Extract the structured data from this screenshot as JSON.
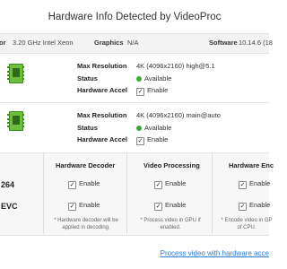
{
  "window": {
    "title": "Hardware Info Detected by VideoProc"
  },
  "infobar": {
    "cpu_label_fragment": "or",
    "cpu_value": "3.20 GHz Intel Xeon",
    "graphics_label": "Graphics",
    "graphics_value": "N/A",
    "software_label": "Software",
    "software_value": "10.14.6 (18"
  },
  "gpus": [
    {
      "max_resolution_label": "Max Resolution",
      "max_resolution_value": "4K (4096x2160) high@5.1",
      "status_label": "Status",
      "status_value": "Available",
      "hw_accel_label": "Hardware Accel",
      "hw_accel_value": "Enable"
    },
    {
      "max_resolution_label": "Max Resolution",
      "max_resolution_value": "4K (4096x2160) main@auto",
      "status_label": "Status",
      "status_value": "Available",
      "hw_accel_label": "Hardware Accel",
      "hw_accel_value": "Enable"
    }
  ],
  "table": {
    "columns": [
      "Hardware Decoder",
      "Video Processing",
      "Hardware Enc"
    ],
    "codecs": [
      "264",
      "EVC"
    ],
    "enable_label": "Enable",
    "notes": [
      "* Hardware decoder will be applied in decoding.",
      "* Process video in GPU if enabled.",
      "* Encode video in GP of CPU."
    ]
  },
  "footer": {
    "link": "Process video with hardware acce"
  },
  "colors": {
    "status_ok": "#3aa93a",
    "link": "#2f7cd3",
    "chip": "#6cbf3c"
  },
  "icons": {
    "gpu": "gpu-chip-icon",
    "check": "checkbox-checked-icon",
    "status": "status-dot-icon"
  }
}
